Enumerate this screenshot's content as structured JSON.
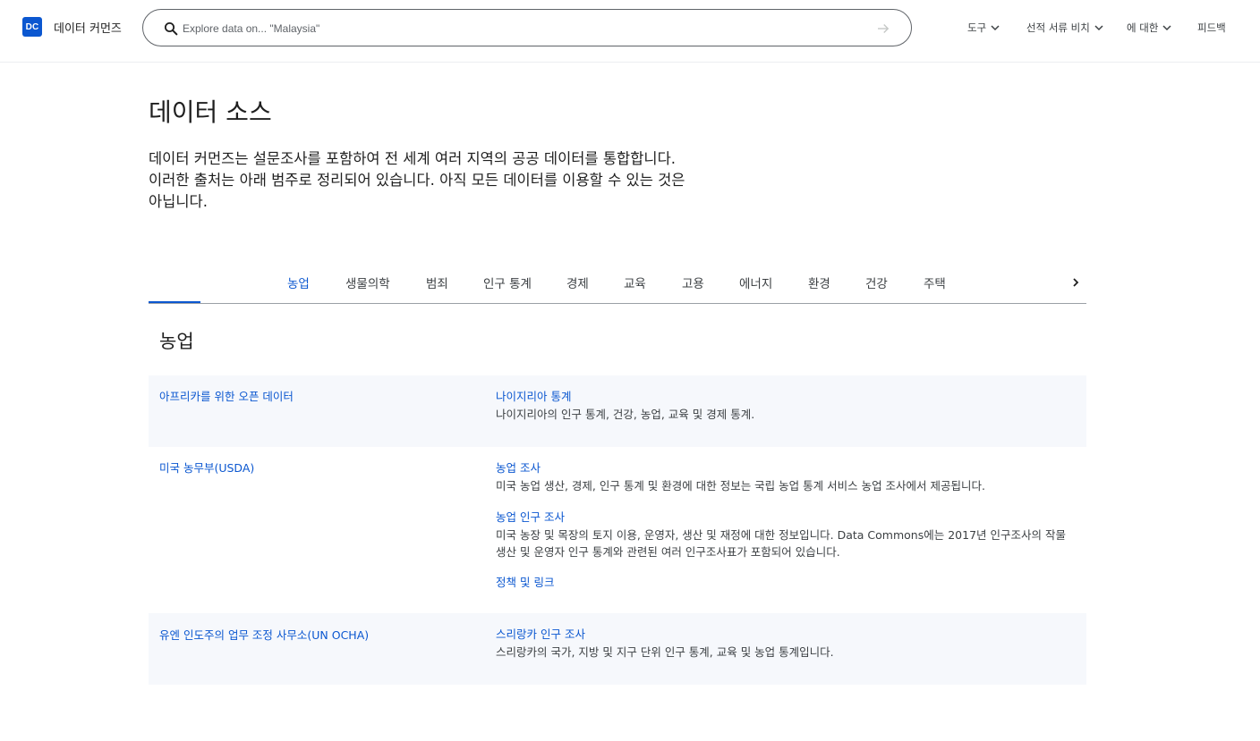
{
  "header": {
    "logo_text": "DC",
    "brand": "데이터 커먼즈",
    "search_placeholder": "Explore data on... \"Malaysia\"",
    "nav": [
      {
        "label": "도구"
      },
      {
        "label": "선적 서류 비치"
      },
      {
        "label": "에 대한"
      },
      {
        "label": "피드백"
      }
    ]
  },
  "main": {
    "title": "데이터 소스",
    "intro": "데이터 커먼즈는 설문조사를 포함하여 전 세계 여러 지역의 공공 데이터를 통합합니다. 이러한 출처는 아래 범주로 정리되어 있습니다. 아직 모든 데이터를 이용할 수 있는 것은 아닙니다.",
    "tabs": [
      "농업",
      "생물의학",
      "범죄",
      "인구 통계",
      "경제",
      "교육",
      "고용",
      "에너지",
      "환경",
      "건강",
      "주택"
    ],
    "active_tab": "농업",
    "section_title": "농업",
    "sources": [
      {
        "org": "아프리카를 위한 오픈 데이터",
        "datasets": [
          {
            "title": "나이지리아 통계",
            "desc": "나이지리아의 인구 통계, 건강, 농업, 교육 및 경제 통계."
          }
        ]
      },
      {
        "org": "미국 농무부(USDA)",
        "datasets": [
          {
            "title": "농업 조사",
            "desc": "미국 농업 생산, 경제, 인구 통계 및 환경에 대한 정보는 국립 농업 통계 서비스 농업 조사에서 제공됩니다."
          },
          {
            "title": "농업 인구 조사",
            "desc": "미국 농장 및 목장의 토지 이용, 운영자, 생산 및 재정에 대한 정보입니다. Data Commons에는 2017년 인구조사의 작물 생산 및 운영자 인구 통계와 관련된 여러 인구조사표가 포함되어 있습니다."
          },
          {
            "title": "정책 및 링크",
            "desc": ""
          }
        ]
      },
      {
        "org": "유엔 인도주의 업무 조정 사무소(UN OCHA)",
        "datasets": [
          {
            "title": "스리랑카 인구 조사",
            "desc": "스리랑카의 국가, 지방 및 지구 단위 인구 통계, 교육 및 농업 통계입니다."
          }
        ]
      }
    ]
  },
  "colors": {
    "accent": "#0b57d0",
    "row_shade": "#f6f8fc",
    "text": "#1f1f1f",
    "muted": "#3c4043"
  },
  "icons": [
    "search-icon",
    "arrow-right-icon",
    "chevron-down-icon",
    "chevron-right-icon"
  ]
}
